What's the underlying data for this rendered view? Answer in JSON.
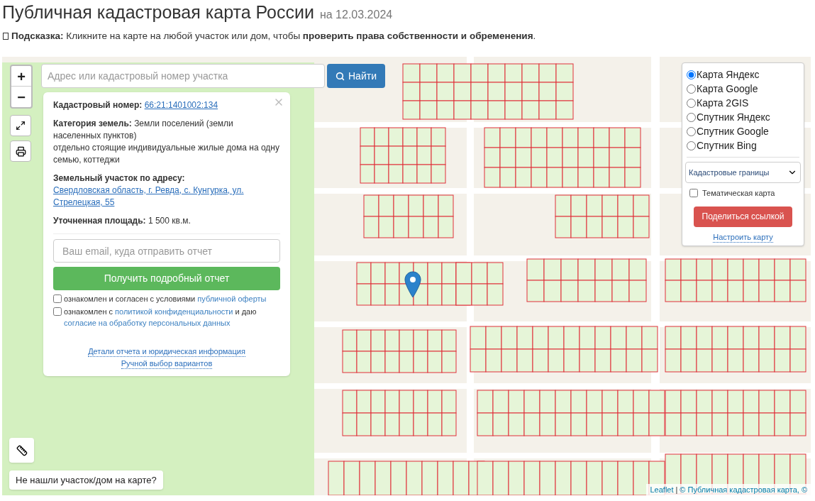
{
  "header": {
    "title": "Публичная кадастровая карта России",
    "date": "на 12.03.2024"
  },
  "hint": {
    "text": "**Подсказка:** Кликните на карте на любой участок или дом, чтобы **проверить права собственности и обременения**."
  },
  "map": {
    "zoom_buttons": [
      "+",
      "−"
    ],
    "search": {
      "placeholder": "Адрес или кадастровый номер участка",
      "button": "Найти"
    },
    "popup": {
      "fields": [
        {
          "kind": "link",
          "label": "Кадастровый номер:",
          "value": "66:21:1401002:134"
        },
        {
          "kind": "text",
          "label": "Категория земель:",
          "value": "Земли поселений (земли населенных пунктов)",
          "note": "отдельно стоящие индивидуальные жилые дома на одну семью, коттеджи"
        },
        {
          "kind": "link",
          "label": "Земельный участок по адресу:",
          "value": "Свердловская область, г. Ревда, с. Кунгурка, ул. Стрелецкая, 55"
        },
        {
          "kind": "text",
          "label": "Уточненная площадь:",
          "value": "1 500 кв.м."
        }
      ],
      "email_placeholder": "Ваш email, куда отправить отчет",
      "report_button": "Получить подробный отчет",
      "agreements": [
        {
          "checked": false,
          "parts": [
            {
              "kind": "text",
              "text": "ознакомлен и согласен с условиями "
            },
            {
              "kind": "link",
              "text": "публичной оферты"
            }
          ]
        },
        {
          "checked": false,
          "parts": [
            {
              "kind": "text",
              "text": "ознакомлен с "
            },
            {
              "kind": "link",
              "text": "политикой конфиденциальности"
            },
            {
              "kind": "text",
              "text": " и даю "
            },
            {
              "kind": "link",
              "text": "согласие на обработку персональных данных"
            }
          ]
        }
      ],
      "links": [
        "Детали отчета и юридическая информация",
        "Ручной выбор вариантов"
      ]
    },
    "layers": [
      {
        "label": "Карта Яндекс",
        "selected": true
      },
      {
        "label": "Карта Google",
        "selected": false
      },
      {
        "label": "Карта 2GIS",
        "selected": false
      },
      {
        "label": "Спутник Яндекс",
        "selected": false
      },
      {
        "label": "Спутник Google",
        "selected": false
      },
      {
        "label": "Спутник Bing",
        "selected": false
      }
    ],
    "overlay_select": "Кадастровые границы",
    "thematic": {
      "label": "Тематическая карта",
      "checked": false
    },
    "share_button": "Поделиться ссылкой",
    "settings_link": "Настроить карту",
    "not_found_button": "Не нашли участок/дом на карте?",
    "attribution": {
      "leaflet": "Leaflet",
      "separator": "|",
      "source": "© Публичная кадастровая карта, ©"
    }
  }
}
